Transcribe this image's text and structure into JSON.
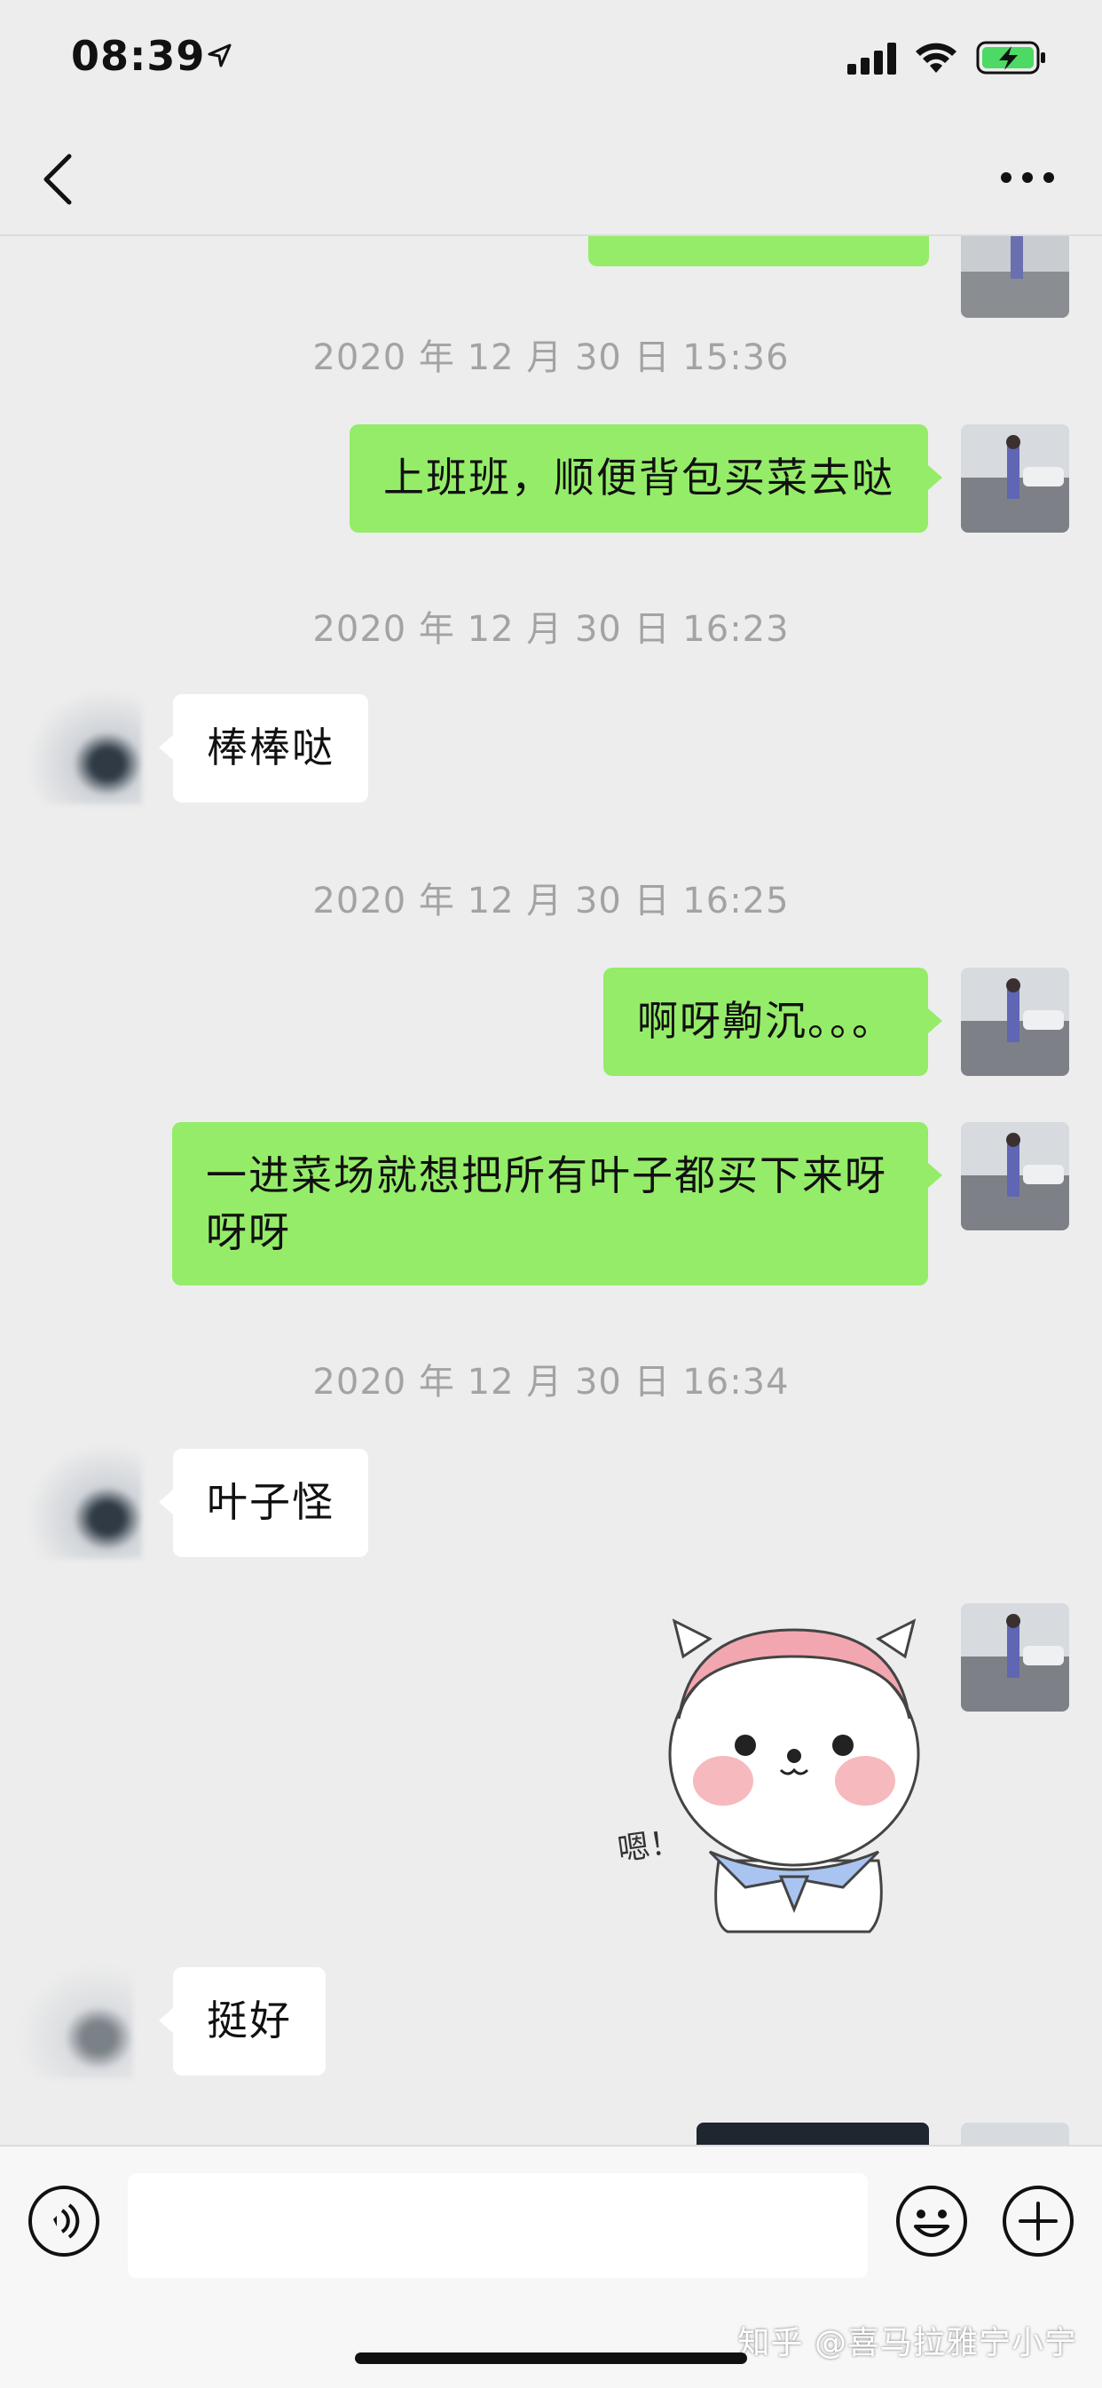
{
  "status_bar": {
    "time": "08:39"
  },
  "chat": {
    "messages": [
      {
        "type": "timestamp",
        "text": "2020 年 12 月 30 日 15:36"
      },
      {
        "type": "text",
        "sender": "me",
        "text": "上班班，顺便背包买菜去哒"
      },
      {
        "type": "timestamp",
        "text": "2020 年 12 月 30 日 16:23"
      },
      {
        "type": "text",
        "sender": "other",
        "text": "棒棒哒"
      },
      {
        "type": "timestamp",
        "text": "2020 年 12 月 30 日 16:25"
      },
      {
        "type": "text",
        "sender": "me",
        "text": "啊呀齁沉。。。"
      },
      {
        "type": "text",
        "sender": "me",
        "text": "一进菜场就想把所有叶子都买下来呀呀呀"
      },
      {
        "type": "timestamp",
        "text": "2020 年 12 月 30 日 16:34"
      },
      {
        "type": "text",
        "sender": "other",
        "text": "叶子怪"
      },
      {
        "type": "sticker",
        "sender": "me",
        "text": "嗯！"
      },
      {
        "type": "text",
        "sender": "other",
        "text": "挺好"
      }
    ]
  },
  "watermark": "知乎 @喜马拉雅宁小宁",
  "icons": {
    "back": "chevron-left-icon",
    "more": "more-dots-icon",
    "voice": "voice-icon",
    "emoji": "emoji-icon",
    "plus": "plus-icon"
  },
  "colors": {
    "my_bubble": "#95ec69",
    "other_bubble": "#ffffff",
    "background": "#ededed"
  }
}
